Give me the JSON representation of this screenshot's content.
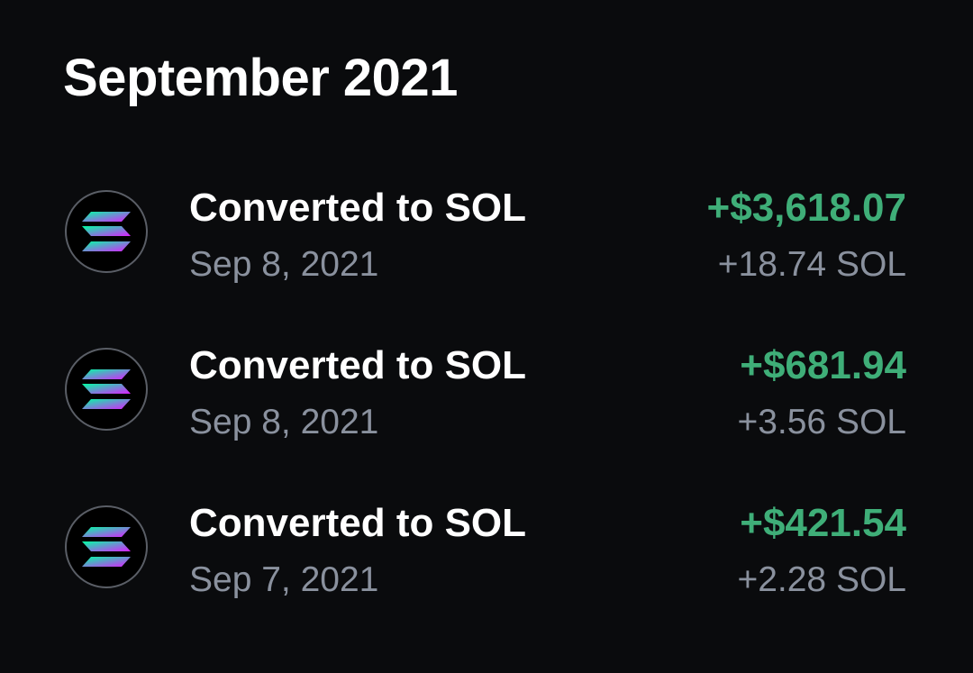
{
  "section": {
    "title": "September 2021"
  },
  "transactions": [
    {
      "title": "Converted to SOL",
      "date": "Sep 8, 2021",
      "amount_usd": "+$3,618.07",
      "amount_crypto": "+18.74 SOL",
      "icon": "solana-icon"
    },
    {
      "title": "Converted to SOL",
      "date": "Sep 8, 2021",
      "amount_usd": "+$681.94",
      "amount_crypto": "+3.56 SOL",
      "icon": "solana-icon"
    },
    {
      "title": "Converted to SOL",
      "date": "Sep 7, 2021",
      "amount_usd": "+$421.54",
      "amount_crypto": "+2.28 SOL",
      "icon": "solana-icon"
    }
  ],
  "colors": {
    "background": "#0a0b0d",
    "positive": "#3fae78",
    "secondary_text": "#8a919e",
    "solana_gradient_start": "#00ffa3",
    "solana_gradient_end": "#dc1fff"
  }
}
